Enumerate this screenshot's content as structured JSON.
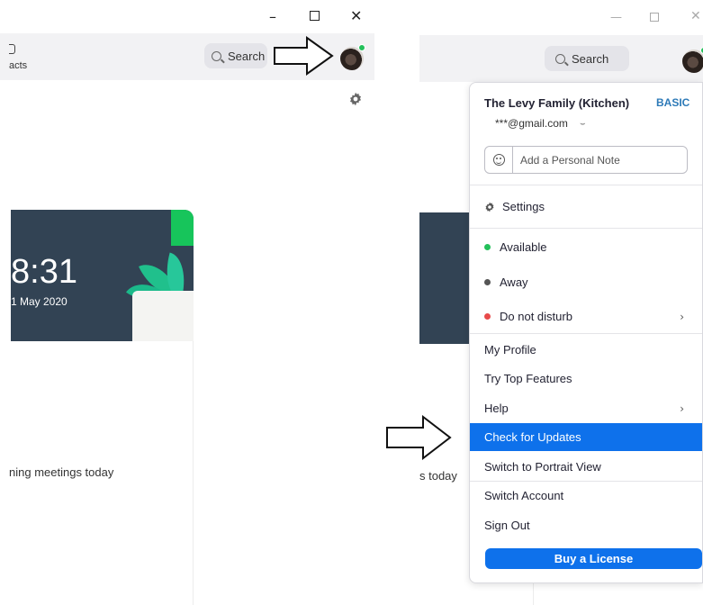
{
  "left_window": {
    "toolbar": {
      "contacts_label": "acts",
      "search_label": "Search"
    },
    "clock": {
      "time": "8:31",
      "date": "1 May 2020"
    },
    "meetings_text": "ning meetings today"
  },
  "right_window": {
    "toolbar": {
      "search_label": "Search"
    },
    "behind_text": "s today",
    "menu": {
      "account_name": "The Levy Family (Kitchen)",
      "plan_badge": "BASIC",
      "email": "***@gmail.com",
      "note_placeholder": "Add a Personal Note",
      "settings_label": "Settings",
      "status_items": [
        {
          "label": "Available",
          "color": "#23c05a"
        },
        {
          "label": "Away",
          "color": "#555555"
        },
        {
          "label": "Do not disturb",
          "color": "#e84a4a"
        }
      ],
      "items": {
        "my_profile": "My Profile",
        "try_top_features": "Try Top Features",
        "help": "Help",
        "check_for_updates": "Check for Updates",
        "switch_portrait": "Switch to Portrait View",
        "switch_account": "Switch Account",
        "sign_out": "Sign Out"
      },
      "buy_license": "Buy a License",
      "highlighted_item": "Check for Updates"
    }
  },
  "colors": {
    "accent": "#0e71eb",
    "available": "#23c05a",
    "dnd": "#e84a4a",
    "card": "#324354"
  }
}
